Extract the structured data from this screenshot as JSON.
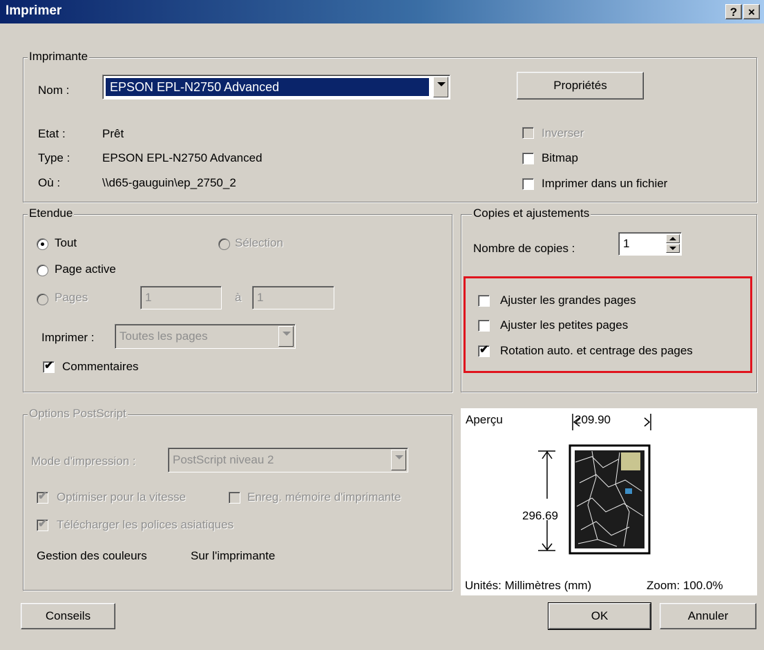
{
  "window": {
    "title": "Imprimer",
    "help": "?",
    "close": "×"
  },
  "printer": {
    "group_title": "Imprimante",
    "name_label": "Nom :",
    "name_value": "EPSON EPL-N2750 Advanced",
    "properties_button": "Propriétés",
    "status_label": "Etat :",
    "status_value": "Prêt",
    "type_label": "Type :",
    "type_value": "EPSON EPL-N2750 Advanced",
    "where_label": "Où :",
    "where_value": "\\\\d65-gauguin\\ep_2750_2",
    "invert_label": "Inverser",
    "bitmap_label": "Bitmap",
    "print_to_file_label": "Imprimer dans un fichier"
  },
  "range": {
    "group_title": "Etendue",
    "all_label": "Tout",
    "selection_label": "Sélection",
    "current_page_label": "Page active",
    "pages_label": "Pages",
    "from_value": "1",
    "to_label": "à",
    "to_value": "1",
    "print_label": "Imprimer :",
    "print_value": "Toutes les pages",
    "comments_label": "Commentaires"
  },
  "copies": {
    "group_title": "Copies et ajustements",
    "count_label": "Nombre de copies :",
    "count_value": "1",
    "fit_large_label": "Ajuster les grandes pages",
    "fit_small_label": "Ajuster les petites pages",
    "auto_rotate_label": "Rotation auto. et centrage des pages"
  },
  "postscript": {
    "group_title": "Options PostScript",
    "mode_label": "Mode d'impression :",
    "mode_value": "PostScript niveau 2",
    "optimize_label": "Optimiser pour la vitesse",
    "save_memory_label": "Enreg. mémoire d'imprimante",
    "download_fonts_label": "Télécharger les polices asiatiques",
    "color_label": "Gestion des couleurs",
    "color_value": "Sur l'imprimante"
  },
  "preview": {
    "title": "Aperçu",
    "width": "209.90",
    "height": "296.69",
    "units": "Unités: Millimètres (mm)",
    "zoom": "Zoom: 100.0%"
  },
  "buttons": {
    "tips": "Conseils",
    "ok": "OK",
    "cancel": "Annuler"
  },
  "colors": {
    "highlight": "#e0141e",
    "selection": "#0a246a"
  }
}
